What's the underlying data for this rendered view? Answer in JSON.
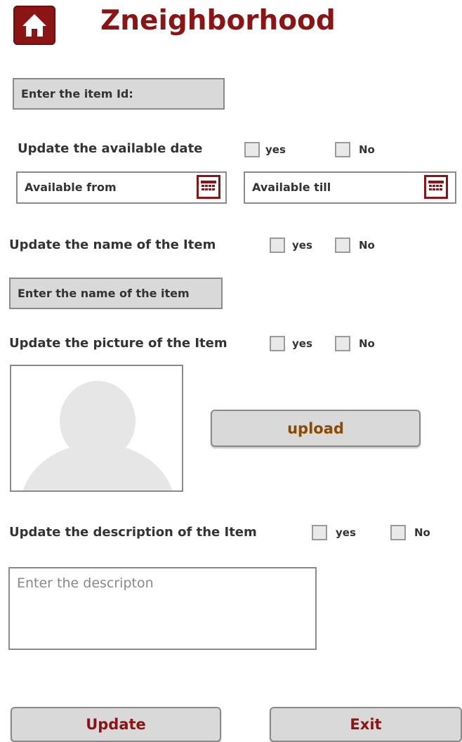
{
  "header": {
    "title": "Zneighborhood",
    "home_icon": "home-icon"
  },
  "item_id": {
    "placeholder": "Enter the item Id:"
  },
  "date_section": {
    "question": "Update the available date",
    "yes_label": "yes",
    "no_label": "No",
    "from_placeholder": "Available from",
    "till_placeholder": "Available till",
    "calendar_icon": "calendar-icon"
  },
  "name_section": {
    "question": "Update the name of the Item",
    "yes_label": "yes",
    "no_label": "No",
    "input_placeholder": "Enter the name of the item"
  },
  "picture_section": {
    "question": "Update the picture of the Item",
    "yes_label": "yes",
    "no_label": "No",
    "placeholder_icon": "person-silhouette-icon",
    "upload_label": "upload"
  },
  "description_section": {
    "question": "Update the description  of the Item",
    "yes_label": "yes",
    "no_label": "No",
    "placeholder": "Enter the descripton"
  },
  "actions": {
    "update_label": "Update",
    "exit_label": "Exit"
  },
  "colors": {
    "brand": "#8b1515",
    "upload_text": "#8b4a00",
    "field_bg": "#d9d9d9",
    "border": "#8a8a8a"
  }
}
